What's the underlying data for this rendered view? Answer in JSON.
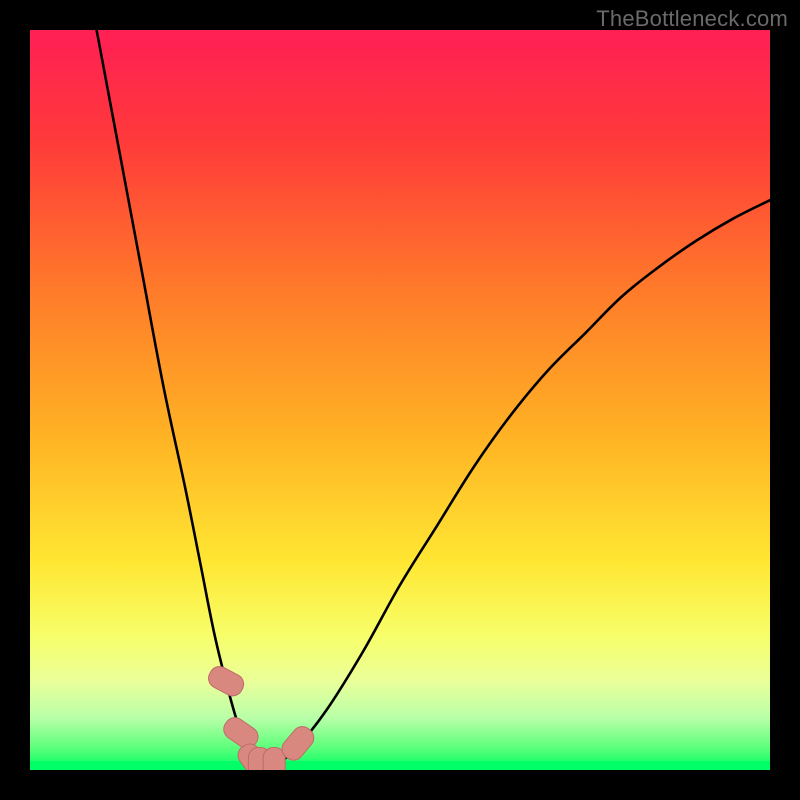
{
  "watermark": "TheBottleneck.com",
  "colors": {
    "frame": "#000000",
    "curve": "#000000",
    "marker_fill": "#d98880",
    "marker_stroke": "#c06a6a",
    "green_band": "#00ff66",
    "gradient_stops": [
      {
        "offset": 0.0,
        "color": "#ff1f55"
      },
      {
        "offset": 0.15,
        "color": "#ff3a3a"
      },
      {
        "offset": 0.35,
        "color": "#ff7a2a"
      },
      {
        "offset": 0.55,
        "color": "#ffb324"
      },
      {
        "offset": 0.72,
        "color": "#ffe733"
      },
      {
        "offset": 0.82,
        "color": "#f7ff6a"
      },
      {
        "offset": 0.88,
        "color": "#eaff9a"
      },
      {
        "offset": 0.93,
        "color": "#b8ffa8"
      },
      {
        "offset": 0.97,
        "color": "#5cff7a"
      },
      {
        "offset": 1.0,
        "color": "#00ff66"
      }
    ]
  },
  "chart_data": {
    "type": "line",
    "title": "",
    "xlabel": "",
    "ylabel": "",
    "xlim": [
      0,
      100
    ],
    "ylim": [
      0,
      100
    ],
    "note": "x and y in percent of plot area; y=0 is the green baseline at the bottom; y=100 is the top edge of the gradient.",
    "series": [
      {
        "name": "bottleneck-curve",
        "x": [
          9,
          12,
          15,
          18,
          21,
          23,
          25,
          27,
          28.5,
          30,
          31.5,
          33,
          36,
          40,
          45,
          50,
          55,
          60,
          65,
          70,
          75,
          80,
          85,
          90,
          95,
          100
        ],
        "y": [
          100,
          84,
          68,
          52,
          38,
          28,
          18,
          10,
          5,
          1.5,
          0.5,
          0.5,
          3,
          8,
          16,
          25,
          33,
          41,
          48,
          54,
          59,
          64,
          68,
          71.5,
          74.5,
          77
        ]
      }
    ],
    "markers": {
      "name": "highlight-points",
      "shape": "rounded-capsule",
      "x": [
        26.5,
        28.5,
        30.2,
        31.0,
        33.0,
        36.2
      ],
      "y": [
        12.0,
        5.0,
        1.2,
        0.6,
        0.6,
        3.6
      ]
    }
  }
}
